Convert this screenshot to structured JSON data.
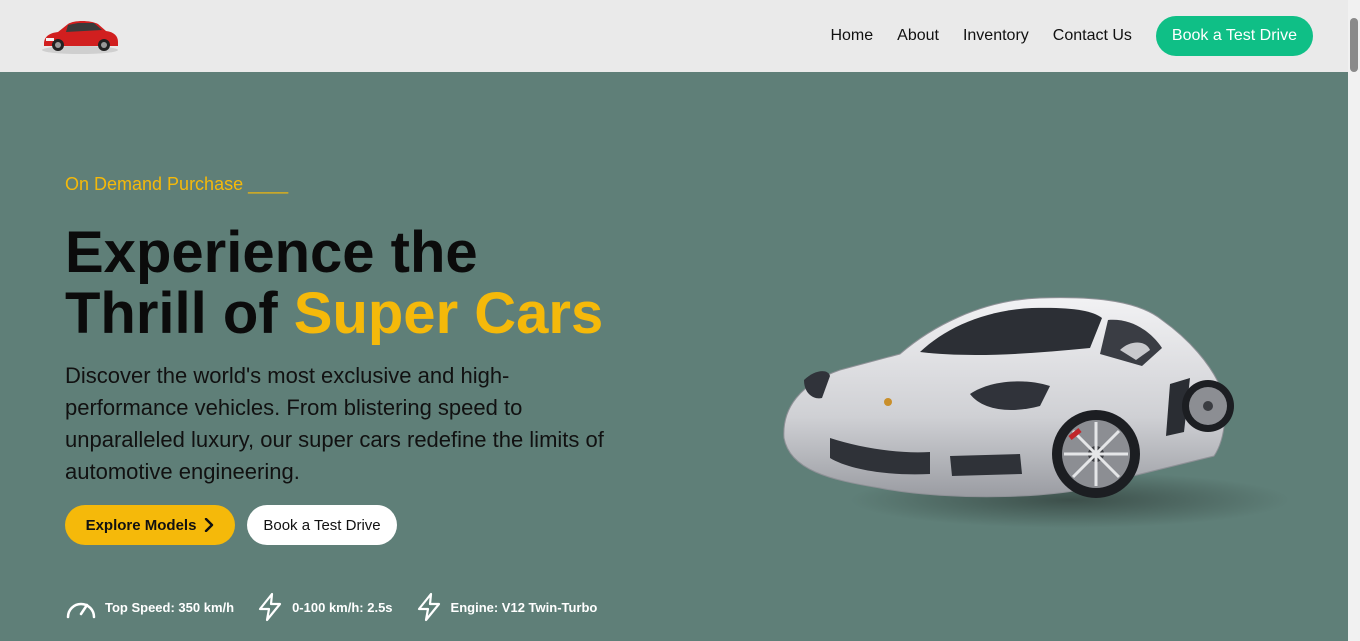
{
  "header": {
    "logo_icon": "car-logo-icon",
    "nav": [
      {
        "label": "Home"
      },
      {
        "label": "About"
      },
      {
        "label": "Inventory"
      },
      {
        "label": "Contact Us"
      }
    ],
    "cta_label": "Book a Test Drive",
    "cta_color": "#0fbf86"
  },
  "hero": {
    "eyebrow": "On Demand Purchase ____",
    "headline_part1": "Experience the",
    "headline_part2": "Thrill of",
    "headline_accent": "Super Cars",
    "description": "Discover the world's most exclusive and high-performance vehicles. From blistering speed to unparalleled luxury, our super cars redefine the limits of automotive engineering.",
    "primary_button": "Explore Models",
    "secondary_button": "Book a Test Drive",
    "accent_color": "#f5b90a",
    "background_color": "#5f7f78",
    "image": "silver-sports-car-image"
  },
  "stats": [
    {
      "icon": "speedometer-icon",
      "label": "Top Speed: 350 km/h"
    },
    {
      "icon": "lightning-icon",
      "label": "0-100 km/h: 2.5s"
    },
    {
      "icon": "lightning-icon",
      "label": "Engine: V12 Twin-Turbo"
    }
  ]
}
